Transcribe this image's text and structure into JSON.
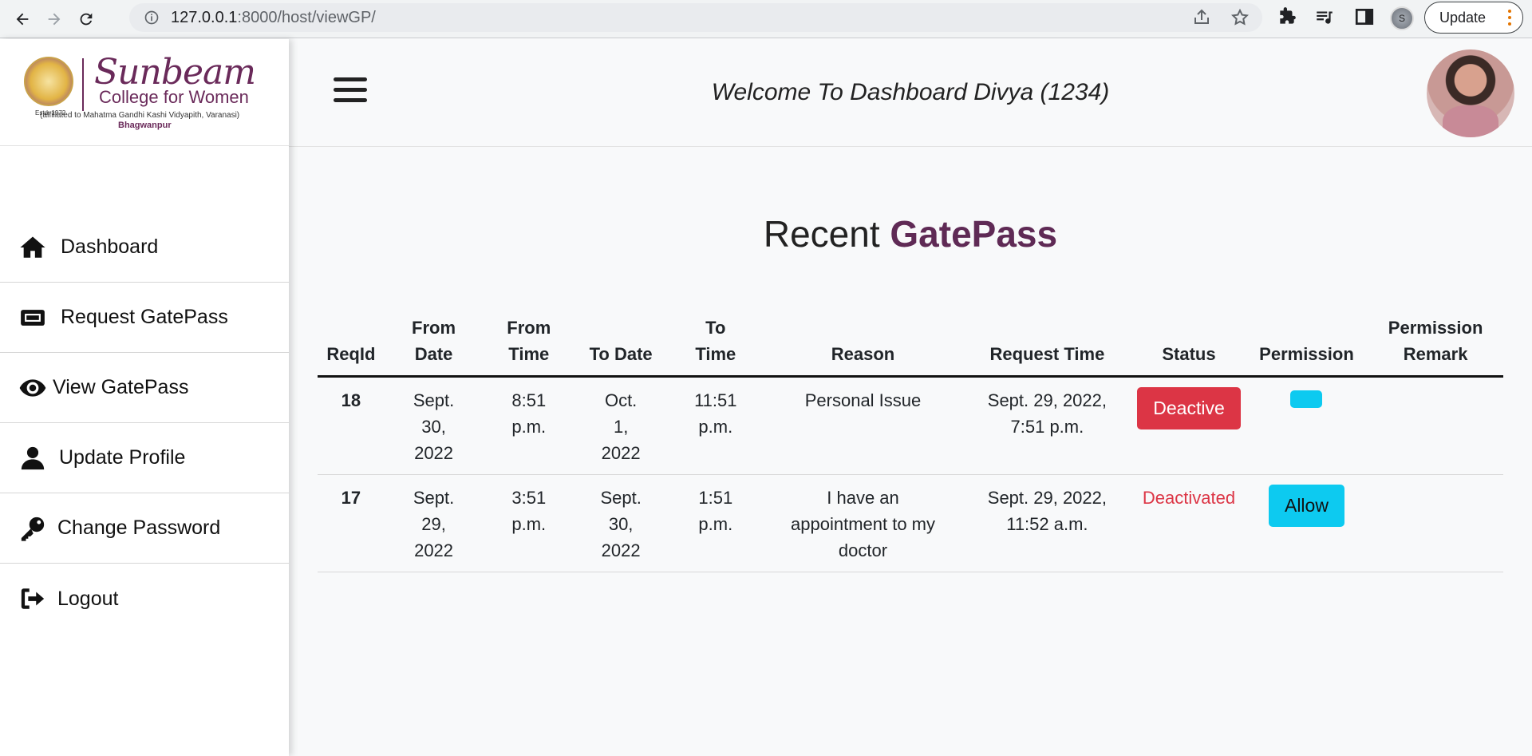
{
  "browser": {
    "url_host": "127.0.0.1",
    "url_path": ":8000/host/viewGP/",
    "profile_initial": "S",
    "update_label": "Update"
  },
  "logo": {
    "estd": "Estd. 1972",
    "name": "Sunbeam",
    "subtitle": "College for Women",
    "affiliation": "(affiliated to Mahatma Gandhi Kashi Vidyapith, Varanasi)",
    "place": "Bhagwanpur"
  },
  "sidebar": {
    "items": [
      {
        "label": "Dashboard",
        "icon": "home-icon"
      },
      {
        "label": "Request GatePass",
        "icon": "ticket-icon"
      },
      {
        "label": "View GatePass",
        "icon": "eye-icon"
      },
      {
        "label": "Update Profile",
        "icon": "user-icon"
      },
      {
        "label": "Change Password",
        "icon": "key-icon"
      },
      {
        "label": "Logout",
        "icon": "logout-icon"
      }
    ]
  },
  "header": {
    "welcome": "Welcome To Dashboard Divya (1234)"
  },
  "main": {
    "title_plain": "Recent",
    "title_bold": "GatePass",
    "columns": [
      "ReqId",
      "From Date",
      "From Time",
      "To Date",
      "To Time",
      "Reason",
      "Request Time",
      "Status",
      "Permission",
      "Permission Remark"
    ],
    "rows": [
      {
        "reqid": "18",
        "from_date": "Sept. 30, 2022",
        "from_time": "8:51 p.m.",
        "to_date": "Oct. 1, 2022",
        "to_time": "11:51 p.m.",
        "reason": "Personal Issue",
        "request_time": "Sept. 29, 2022, 7:51 p.m.",
        "status": "Deactive",
        "permission": "",
        "remark": ""
      },
      {
        "reqid": "17",
        "from_date": "Sept. 29, 2022",
        "from_time": "3:51 p.m.",
        "to_date": "Sept. 30, 2022",
        "to_time": "1:51 p.m.",
        "reason": "I have an appointment to my doctor",
        "request_time": "Sept. 29, 2022, 11:52 a.m.",
        "status": "Deactivated",
        "permission": "Allow",
        "remark": ""
      }
    ]
  },
  "colors": {
    "brand": "#5f2a55",
    "danger": "#dc3545",
    "info": "#0dcaf0"
  }
}
